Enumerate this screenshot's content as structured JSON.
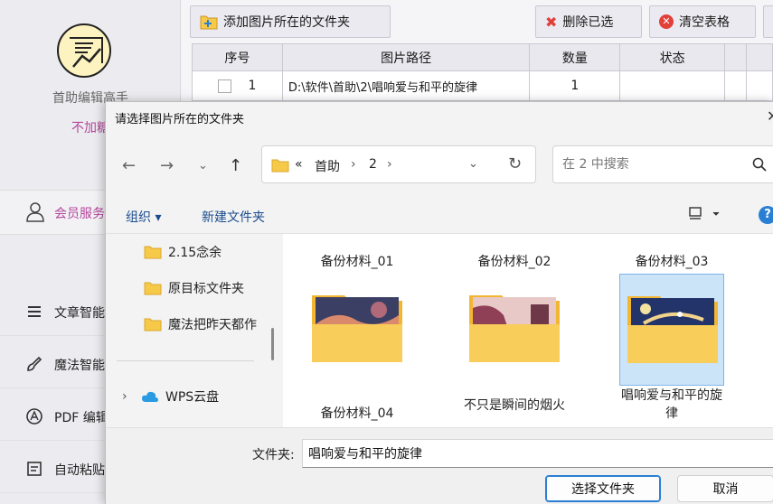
{
  "app": {
    "name": "首助编辑高手",
    "subtitle": "不加糖",
    "member": "会员服务",
    "sidebar": [
      {
        "label": "文章智能"
      },
      {
        "label": "魔法智能"
      },
      {
        "label": "PDF 编辑"
      },
      {
        "label": "自动粘贴"
      }
    ]
  },
  "toolbar": {
    "add_folder": "添加图片所在的文件夹",
    "delete_selected": "删除已选",
    "clear_table": "清空表格"
  },
  "table": {
    "headers": [
      "序号",
      "图片路径",
      "数量",
      "状态"
    ],
    "rows": [
      {
        "index": "1",
        "path": "D:\\软件\\首助\\2\\唱响爱与和平的旋律",
        "count": "1",
        "status": ""
      }
    ]
  },
  "dialog": {
    "title": "请选择图片所在的文件夹",
    "breadcrumb": {
      "overflow": "«",
      "items": [
        "首助",
        "2"
      ]
    },
    "search_placeholder": "在 2 中搜索",
    "commands": {
      "organize": "组织 ▾",
      "new_folder": "新建文件夹"
    },
    "tree": [
      {
        "label": "2.15念余"
      },
      {
        "label": "原目标文件夹"
      },
      {
        "label": "魔法把昨天都作"
      },
      {
        "label": "WPS云盘",
        "arrow": "›"
      }
    ],
    "files": [
      {
        "name": "备份材料_01"
      },
      {
        "name": "备份材料_02"
      },
      {
        "name": "备份材料_03"
      },
      {
        "name": "备份材料_04"
      },
      {
        "name": "不只是瞬间的烟火"
      },
      {
        "name": "唱响爱与和平的旋律"
      }
    ],
    "folder_label": "文件夹:",
    "folder_value": "唱响爱与和平的旋律",
    "select_button": "选择文件夹",
    "cancel_button": "取消"
  },
  "colors": {
    "accent": "#2a7fd4",
    "folder": "#f7c948",
    "brand_pink": "#b4479c",
    "selection": "#cce4f7"
  }
}
